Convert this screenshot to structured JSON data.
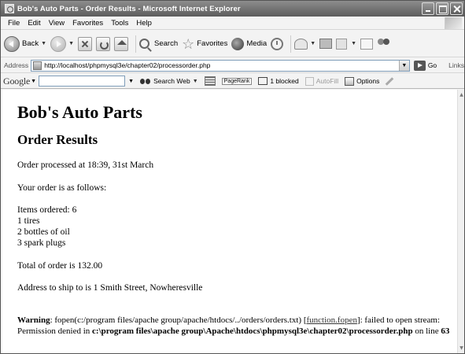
{
  "window": {
    "title": "Bob's Auto Parts - Order Results - Microsoft Internet Explorer"
  },
  "menu": [
    "File",
    "Edit",
    "View",
    "Favorites",
    "Tools",
    "Help"
  ],
  "toolbar": {
    "back_label": "Back",
    "search_label": "Search",
    "favorites_label": "Favorites",
    "media_label": "Media"
  },
  "address": {
    "label": "Address",
    "url": "http://localhost/phpmysql3e/chapter02/processorder.php",
    "go_label": "Go",
    "links_label": "Links"
  },
  "google_toolbar": {
    "logo": "Google",
    "search_web_label": "Search Web",
    "pagerank_label": "PageRank",
    "blocked_label": "1 blocked",
    "autofill_label": "AutoFill",
    "options_label": "Options"
  },
  "page": {
    "heading": "Bob's Auto Parts",
    "subheading": "Order Results",
    "processed": "Order processed at 18:39, 31st March",
    "intro": "Your order is as follows:",
    "items_ordered": "Items ordered: 6",
    "items": [
      "1 tires",
      "2 bottles of oil",
      "3 spark plugs"
    ],
    "total": "Total of order is 132.00",
    "address": "Address to ship to is 1 Smith Street, Nowheresville",
    "warning": {
      "label": "Warning",
      "text_before_link": ": fopen(c:/program files/apache group/apache/htdocs/../orders/orders.txt) [",
      "link_text": "function.fopen",
      "text_after_link": "]: failed to open stream: Permission denied in ",
      "file_path": "c:\\program files\\apache group\\Apache\\htdocs\\phpmysql3e\\chapter02\\processorder.php",
      "on_line_text": " on line ",
      "line_number": "63"
    }
  }
}
